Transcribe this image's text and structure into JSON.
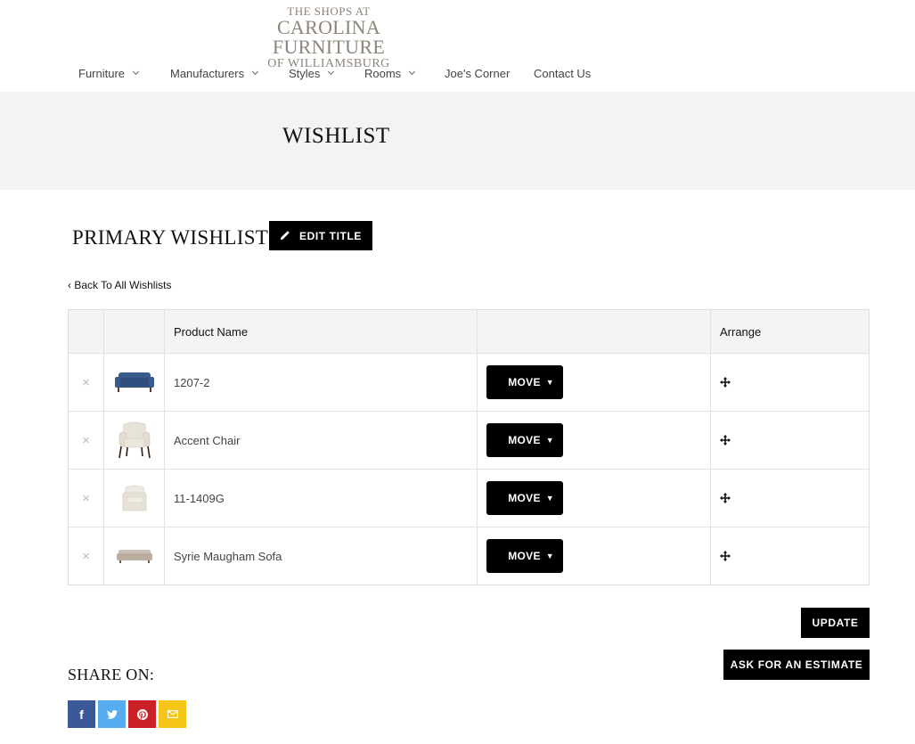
{
  "logo": {
    "line1": "THE SHOPS AT",
    "line2": "CAROLINA FURNITURE",
    "line3": "OF WILLIAMSBURG"
  },
  "nav": {
    "items": [
      {
        "label": "Furniture",
        "dropdown": true
      },
      {
        "label": "Manufacturers",
        "dropdown": true
      },
      {
        "label": "Styles",
        "dropdown": true
      },
      {
        "label": "Rooms",
        "dropdown": true
      },
      {
        "label": "Joe's Corner",
        "dropdown": false
      },
      {
        "label": "Contact Us",
        "dropdown": false
      }
    ]
  },
  "banner": {
    "title": "WISHLIST"
  },
  "wishlist": {
    "title": "PRIMARY WISHLIST",
    "edit_label": "EDIT TITLE",
    "back_label": "‹ Back To All Wishlists"
  },
  "table": {
    "headers": {
      "product": "Product Name",
      "arrange": "Arrange"
    },
    "remove_symbol": "×",
    "rows": [
      {
        "name": "1207-2",
        "move_label": "MOVE",
        "thumb": "blue-sofa"
      },
      {
        "name": "Accent Chair",
        "move_label": "MOVE",
        "thumb": "accent-chair"
      },
      {
        "name": "11-1409G",
        "move_label": "MOVE",
        "thumb": "slipcover-chair"
      },
      {
        "name": "Syrie Maugham Sofa",
        "move_label": "MOVE",
        "thumb": "beige-sofa"
      }
    ]
  },
  "actions": {
    "update_label": "UPDATE",
    "estimate_label": "ASK FOR AN ESTIMATE"
  },
  "share": {
    "title": "SHARE ON:",
    "icons": [
      {
        "name": "facebook-icon",
        "color": "#3b5998",
        "glyph": "f"
      },
      {
        "name": "twitter-icon",
        "color": "#55acee",
        "glyph": "t"
      },
      {
        "name": "pinterest-icon",
        "color": "#cb2027",
        "glyph": "p"
      },
      {
        "name": "email-icon",
        "color": "#f5c518",
        "glyph": "✉"
      }
    ]
  },
  "colors": {
    "button": "#000000",
    "banner_bg": "#f3f3f3",
    "logo": "#8d857a"
  }
}
